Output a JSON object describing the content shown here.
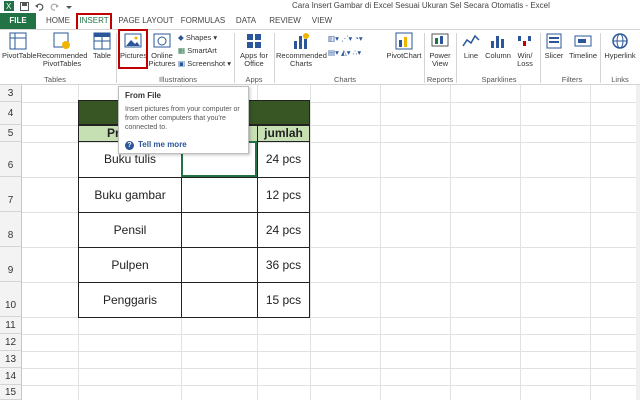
{
  "window": {
    "title": "Cara Insert Gambar di Excel Sesuai Ukuran Sel Secara Otomatis - Excel"
  },
  "qat": {
    "save_icon": "save-icon",
    "undo_icon": "undo-icon",
    "redo_icon": "redo-icon"
  },
  "tabs": [
    "FILE",
    "HOME",
    "INSERT",
    "PAGE LAYOUT",
    "FORMULAS",
    "DATA",
    "REVIEW",
    "VIEW"
  ],
  "ribbon": {
    "tables": {
      "pivottable": "PivotTable",
      "recommended": "Recommended PivotTables",
      "table": "Table",
      "label": "Tables"
    },
    "illustrations": {
      "pictures": "Pictures",
      "online": "Online Pictures",
      "shapes": "Shapes",
      "smartart": "SmartArt",
      "screenshot": "Screenshot",
      "label": "Illustrations"
    },
    "apps": {
      "apps_office": "Apps for Office",
      "label": "Apps"
    },
    "charts": {
      "recommended": "Recommended Charts",
      "pivotchart": "PivotChart",
      "label": "Charts"
    },
    "reports": {
      "powerview": "Power View",
      "label": "Reports"
    },
    "sparklines": {
      "line": "Line",
      "column": "Column",
      "winloss": "Win/ Loss",
      "label": "Sparklines"
    },
    "filters": {
      "slicer": "Slicer",
      "timeline": "Timeline",
      "label": "Filters"
    },
    "links": {
      "hyperlink": "Hyperlink",
      "label": "Links"
    }
  },
  "tooltip": {
    "title": "From File",
    "body": "Insert pictures from your computer or from other computers that you're connected to.",
    "help": "Tell me more"
  },
  "rows": [
    "3",
    "4",
    "5",
    "6",
    "7",
    "8",
    "9",
    "10",
    "11",
    "12",
    "13",
    "14",
    "15"
  ],
  "table": {
    "header_left": "Pr",
    "header_right": "jumlah",
    "items": [
      {
        "name": "Buku tulis",
        "qty": "24 pcs"
      },
      {
        "name": "Buku gambar",
        "qty": "12 pcs"
      },
      {
        "name": "Pensil",
        "qty": "24 pcs"
      },
      {
        "name": "Pulpen",
        "qty": "36 pcs"
      },
      {
        "name": "Penggaris",
        "qty": "15 pcs"
      }
    ]
  },
  "colors": {
    "excel_green": "#217346",
    "highlight_red": "#c00000",
    "header_dark": "#375623",
    "header_light": "#c6e0b4"
  }
}
